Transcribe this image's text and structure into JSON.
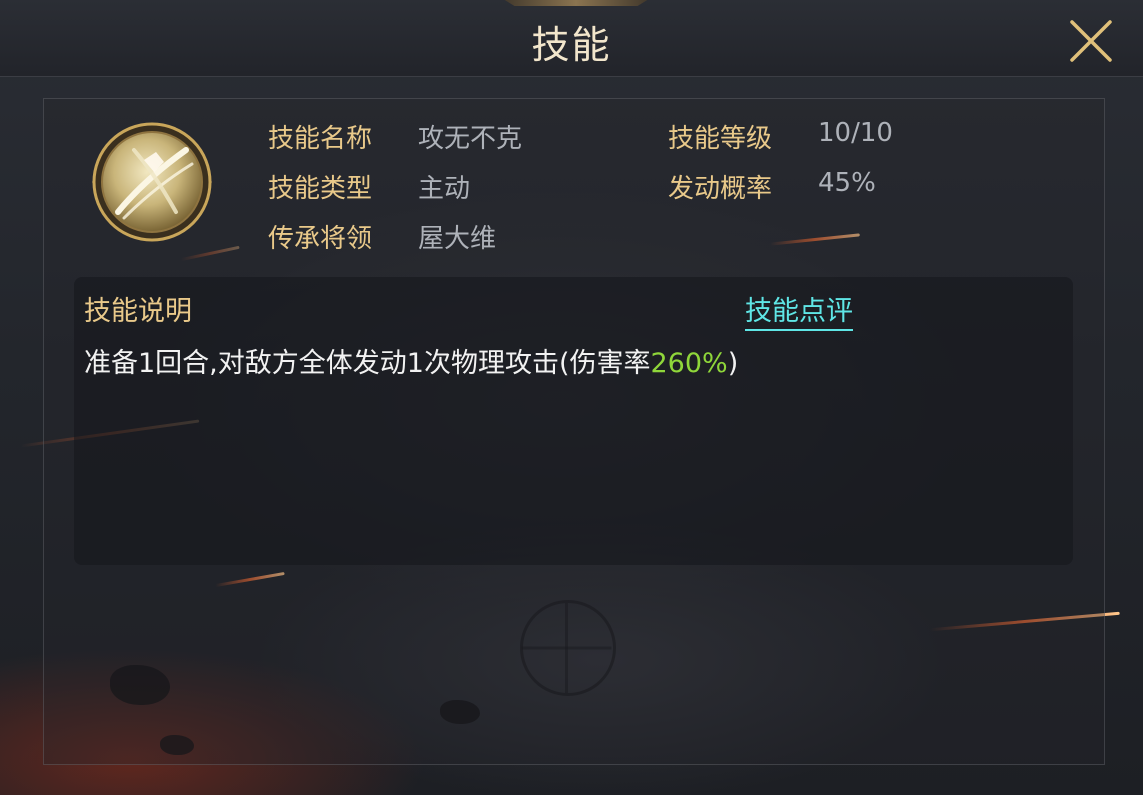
{
  "header": {
    "title": "技能"
  },
  "skill": {
    "name_label": "技能名称",
    "name_value": "攻无不克",
    "level_label": "技能等级",
    "level_value": "10/10",
    "type_label": "技能类型",
    "type_value": "主动",
    "rate_label": "发动概率",
    "rate_value": "45%",
    "inherit_label": "传承将领",
    "inherit_value": "屋大维"
  },
  "description": {
    "title": "技能说明",
    "review_link": "技能点评",
    "text_before": "准备1回合,对敌方全体发动1次物理攻击(伤害率",
    "text_highlight": "260%",
    "text_after": ")"
  },
  "icons": {
    "close": "close-x-icon",
    "skill": "sword-slash-skill-icon"
  },
  "colors": {
    "label_gold": "#e9c98a",
    "value_grey": "#aeb2b9",
    "link_cyan": "#5fe6e6",
    "highlight_green": "#8fd63a"
  }
}
